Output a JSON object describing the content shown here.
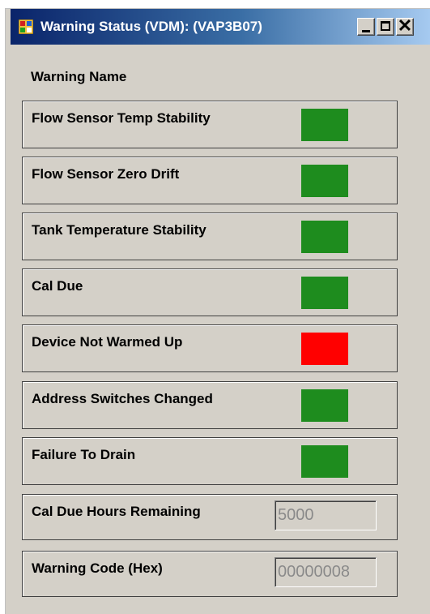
{
  "window": {
    "title": "Warning Status (VDM): (VAP3B07)",
    "minimize_icon": "minimize-icon",
    "maximize_icon": "maximize-icon",
    "close_icon": "close-icon"
  },
  "header": {
    "warning_name_label": "Warning Name"
  },
  "warnings": [
    {
      "label": "Flow Sensor Temp Stability",
      "status": "ok",
      "color": "#1e8c1e"
    },
    {
      "label": "Flow Sensor Zero Drift",
      "status": "ok",
      "color": "#1e8c1e"
    },
    {
      "label": "Tank Temperature Stability",
      "status": "ok",
      "color": "#1e8c1e"
    },
    {
      "label": "Cal Due",
      "status": "ok",
      "color": "#1e8c1e"
    },
    {
      "label": "Device Not Warmed Up",
      "status": "warning",
      "color": "#ff0000"
    },
    {
      "label": "Address Switches Changed",
      "status": "ok",
      "color": "#1e8c1e"
    },
    {
      "label": "Failure To Drain",
      "status": "ok",
      "color": "#1e8c1e"
    }
  ],
  "fields": [
    {
      "label": "Cal Due Hours Remaining",
      "value": "5000"
    },
    {
      "label": "Warning Code (Hex)",
      "value": "00000008"
    }
  ]
}
